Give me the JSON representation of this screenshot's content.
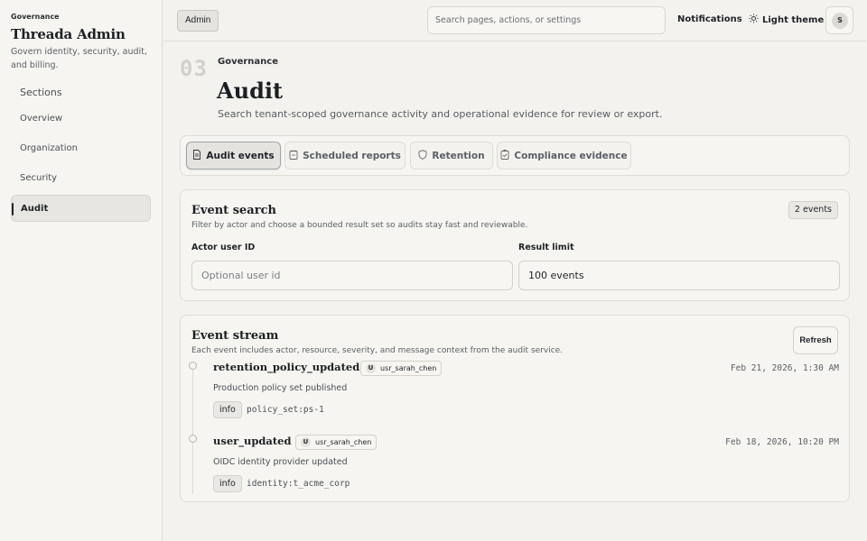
{
  "sidebar": {
    "eyebrow": "Governance",
    "title": "Threada Admin",
    "description": "Govern identity, security, audit, and billing.",
    "sections_label": "Sections",
    "items": [
      {
        "label": "Overview"
      },
      {
        "label": "Organization"
      },
      {
        "label": "Security"
      },
      {
        "label": "Audit"
      }
    ],
    "active_item": "Audit"
  },
  "topbar": {
    "admin_label": "Admin",
    "search_placeholder": "Search pages, actions, or settings",
    "notifications_label": "Notifications",
    "theme_label": "Light theme",
    "avatar_initial": "S"
  },
  "header": {
    "page_number": "03",
    "breadcrumb": "Governance",
    "title": "Audit",
    "subtitle": "Search tenant-scoped governance activity and operational evidence for review or export."
  },
  "tabs": [
    {
      "label": "Audit events",
      "icon": "document-icon",
      "active": true
    },
    {
      "label": "Scheduled reports",
      "icon": "calendar-doc-icon",
      "active": false
    },
    {
      "label": "Retention",
      "icon": "shield-icon",
      "active": false
    },
    {
      "label": "Compliance evidence",
      "icon": "document-check-icon",
      "active": false
    }
  ],
  "search_card": {
    "title": "Event search",
    "subtitle": "Filter by actor and choose a bounded result set so audits stay fast and reviewable.",
    "count_badge": "2 events",
    "actor_label": "Actor user ID",
    "actor_placeholder": "Optional user id",
    "limit_label": "Result limit",
    "limit_value": "100 events"
  },
  "stream_card": {
    "title": "Event stream",
    "subtitle": "Each event includes actor, resource, severity, and message context from the audit service.",
    "refresh_label": "Refresh",
    "events": [
      {
        "name": "retention_policy_updated",
        "user_initial": "U",
        "user": "usr_sarah_chen",
        "time": "Feb 21, 2026, 1:30 AM",
        "message": "Production policy set published",
        "severity": "info",
        "resource": "policy_set:ps-1"
      },
      {
        "name": "user_updated",
        "user_initial": "U",
        "user": "usr_sarah_chen",
        "time": "Feb 18, 2026, 10:20 PM",
        "message": "OIDC identity provider updated",
        "severity": "info",
        "resource": "identity:t_acme_corp"
      }
    ]
  },
  "colors": {
    "background": "#f3f2ee",
    "panel": "#f6f5f1",
    "border": "#dedcd5",
    "text": "#1f2328"
  }
}
